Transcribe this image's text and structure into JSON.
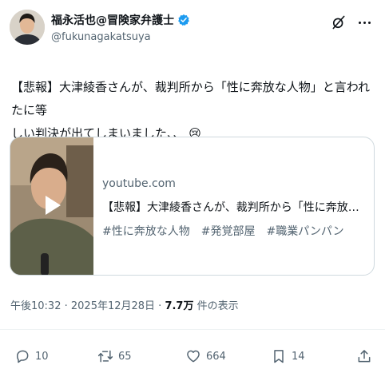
{
  "author": {
    "display_name": "福永活也@冒険家弁護士",
    "handle": "@fukunagakatsuya",
    "verified": true
  },
  "tweet": {
    "text_line1": "【悲報】大津綾香さんが、裁判所から「性に奔放な人物」と言われたに等",
    "text_line2": "しい判決が出てしまいました、、",
    "emoji": "😢"
  },
  "card": {
    "domain": "youtube.com",
    "title": "【悲報】大津綾香さんが、裁判所から「性に奔放な人物」...",
    "description": "#性に奔放な人物　#発覚部屋　#職業パンパン"
  },
  "meta": {
    "time": "午後10:32",
    "separator1": " · ",
    "date": "2025年12月28日",
    "separator2": " · ",
    "views_count": "7.7万",
    "views_label": " 件の表示"
  },
  "actions": {
    "replies": "10",
    "reposts": "65",
    "likes": "664",
    "bookmarks": "14"
  },
  "colors": {
    "text_primary": "#0f1419",
    "text_secondary": "#536471",
    "verified_blue": "#1d9bf0",
    "border": "#cfd9de"
  },
  "icons": {
    "verified": "verified-badge-icon",
    "grok": "grok-icon",
    "more": "more-icon",
    "reply": "reply-icon",
    "repost": "repost-icon",
    "like": "like-icon",
    "bookmark": "bookmark-icon",
    "share": "share-icon",
    "play": "play-icon"
  }
}
